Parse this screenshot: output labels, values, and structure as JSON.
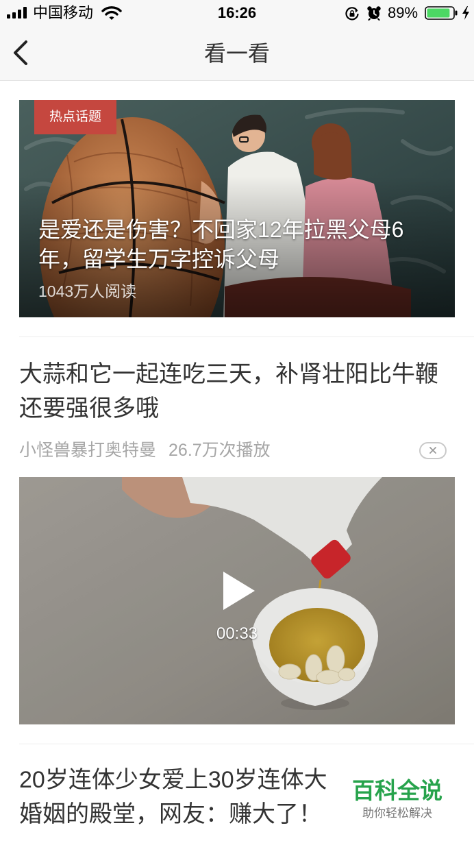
{
  "status_bar": {
    "carrier": "中国移动",
    "time": "16:26",
    "battery_text": "89%",
    "battery_level": 0.89,
    "icons": {
      "signal": "signal-icon",
      "wifi": "wifi-icon",
      "orientation_lock": "rotation-lock-icon",
      "alarm": "alarm-icon",
      "battery": "battery-icon",
      "charging": "charging-bolt-icon"
    }
  },
  "nav": {
    "back_icon": "chevron-left-icon",
    "title": "看一看"
  },
  "feed": {
    "hot_topic": {
      "badge": "热点话题",
      "title_lines": [
        "是爱还是伤害？不回家12年拉黑父母6",
        "年，留学生万字控诉父母"
      ],
      "reads": "1043万人阅读"
    },
    "video_article": {
      "title_lines": [
        "大蒜和它一起连吃三天，补肾壮阳比牛鞭",
        "还要强很多哦"
      ],
      "author": "小怪兽暴打奥特曼",
      "plays": "26.7万次播放",
      "dismiss_icon": "close-icon",
      "play_icon": "play-icon",
      "duration": "00:33"
    },
    "article_3": {
      "title_lines": [
        "20岁连体少女爱上30岁连体大",
        "婚姻的殿堂，网友：赚大了！"
      ]
    }
  },
  "watermark": {
    "title": "百科全说",
    "subtitle": "助你轻松解决"
  },
  "colors": {
    "badge": "#c5473f",
    "watermark_green": "#27a34c",
    "battery_fill": "#4cd964",
    "title_text": "#333333",
    "meta_text": "#a6a6a6"
  }
}
